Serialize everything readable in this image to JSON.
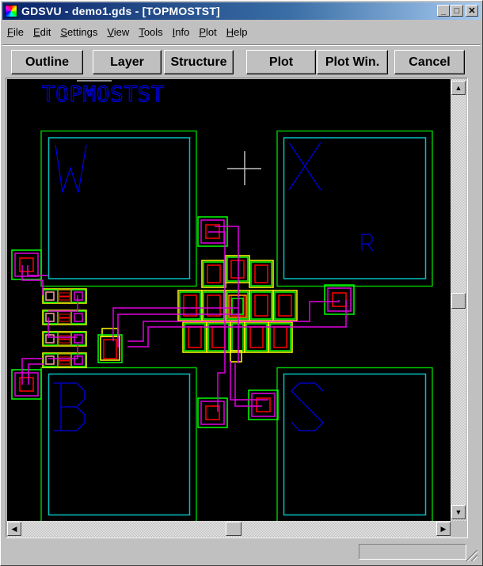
{
  "window": {
    "title": "GDSVU - demo1.gds - [TOPMOSTST]",
    "controls": {
      "minimize": "_",
      "maximize": "□",
      "close": "✕"
    }
  },
  "menu": [
    {
      "label": "File",
      "accel": "F",
      "rest": "ile"
    },
    {
      "label": "Edit",
      "accel": "E",
      "rest": "dit"
    },
    {
      "label": "Settings",
      "accel": "S",
      "rest": "ettings"
    },
    {
      "label": "View",
      "accel": "V",
      "rest": "iew"
    },
    {
      "label": "Tools",
      "accel": "T",
      "rest": "ools"
    },
    {
      "label": "Info",
      "accel": "I",
      "rest": "nfo"
    },
    {
      "label": "Plot",
      "accel": "P",
      "rest": "lot"
    },
    {
      "label": "Help",
      "accel": "H",
      "rest": "elp"
    }
  ],
  "toolbar": {
    "outline": "Outline",
    "layer": "Layer",
    "structure": "Structure",
    "plot": "Plot",
    "plot_win": "Plot Win.",
    "cancel": "Cancel"
  },
  "layout": {
    "structure_name": "TOPMOSTST",
    "pad_labels": [
      "W",
      "X",
      "B",
      "S",
      "R"
    ],
    "layer_colors": {
      "background": "#000000",
      "pad_outer": "#00c000",
      "pad_inner": "#00c0c0",
      "text": "#0000e0",
      "diffusion": "#ffff00",
      "active": "#00ff00",
      "contact": "#ff0000",
      "metal": "#e000e0",
      "cursor": "#c0c0c0"
    }
  },
  "scrollbars": {
    "up_icon": "▲",
    "down_icon": "▼",
    "left_icon": "◀",
    "right_icon": "▶",
    "vertical_position": 0.49,
    "horizontal_position": 0.53
  },
  "status": {
    "text": ""
  }
}
